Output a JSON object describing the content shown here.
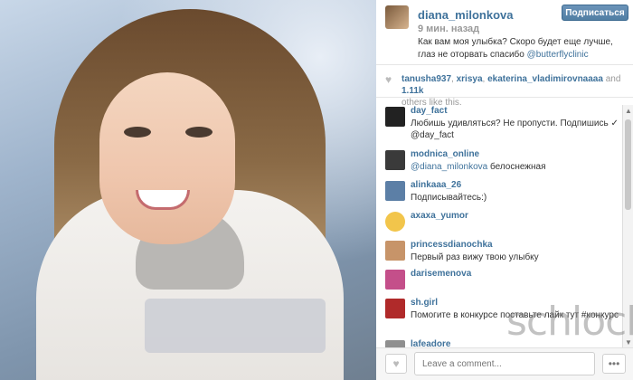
{
  "post": {
    "username": "diana_milonkova",
    "time_ago": "9 мин. назад",
    "follow_label": "Подписаться",
    "caption_main": "Как вам моя улыбка? Скоро будет еще лучше, глаз не оторвать спасибо ",
    "caption_mention": "@butterflyclinic"
  },
  "likes": {
    "users": [
      "tanusha937",
      "xrisya",
      "ekaterina_vladimirovnaaaa"
    ],
    "separator": ", ",
    "and": " and ",
    "count": "1.11k",
    "suffix": "others like this."
  },
  "comments": [
    {
      "user": "day_fact",
      "text": "Любишь удивляться? Не пропусти. Подпишись ✓ @day_fact",
      "avatar_color": "#222222"
    },
    {
      "user": "modnica_online",
      "text_prefix": "@diana_milonkova",
      "text": " белоснежная",
      "avatar_color": "#3a3a3a"
    },
    {
      "user": "alinkaaa_26",
      "text": "Подписывайтесь:)",
      "avatar_color": "#5c7fa6"
    },
    {
      "user": "axaxa_yumor",
      "text": "",
      "avatar_color": "#f2c54b"
    },
    {
      "user": "princessdianochka",
      "text": "Первый раз вижу твою улыбку",
      "avatar_color": "#c79469"
    },
    {
      "user": "darisemenova",
      "text": "",
      "avatar_color": "#c44f8a"
    },
    {
      "user": "sh.girl",
      "text": "Помогите в конкурсе поставьте лайк тут #конкурс",
      "avatar_color": "#b02a2a"
    },
    {
      "user": "lafeadore",
      "text": "",
      "avatar_color": "#8f8f8f"
    }
  ],
  "footer": {
    "comment_placeholder": "Leave a comment...",
    "more_label": "•••"
  },
  "watermark": "schlock.ru",
  "colors": {
    "link": "#3f729b",
    "follow_bg": "#517fa4"
  }
}
